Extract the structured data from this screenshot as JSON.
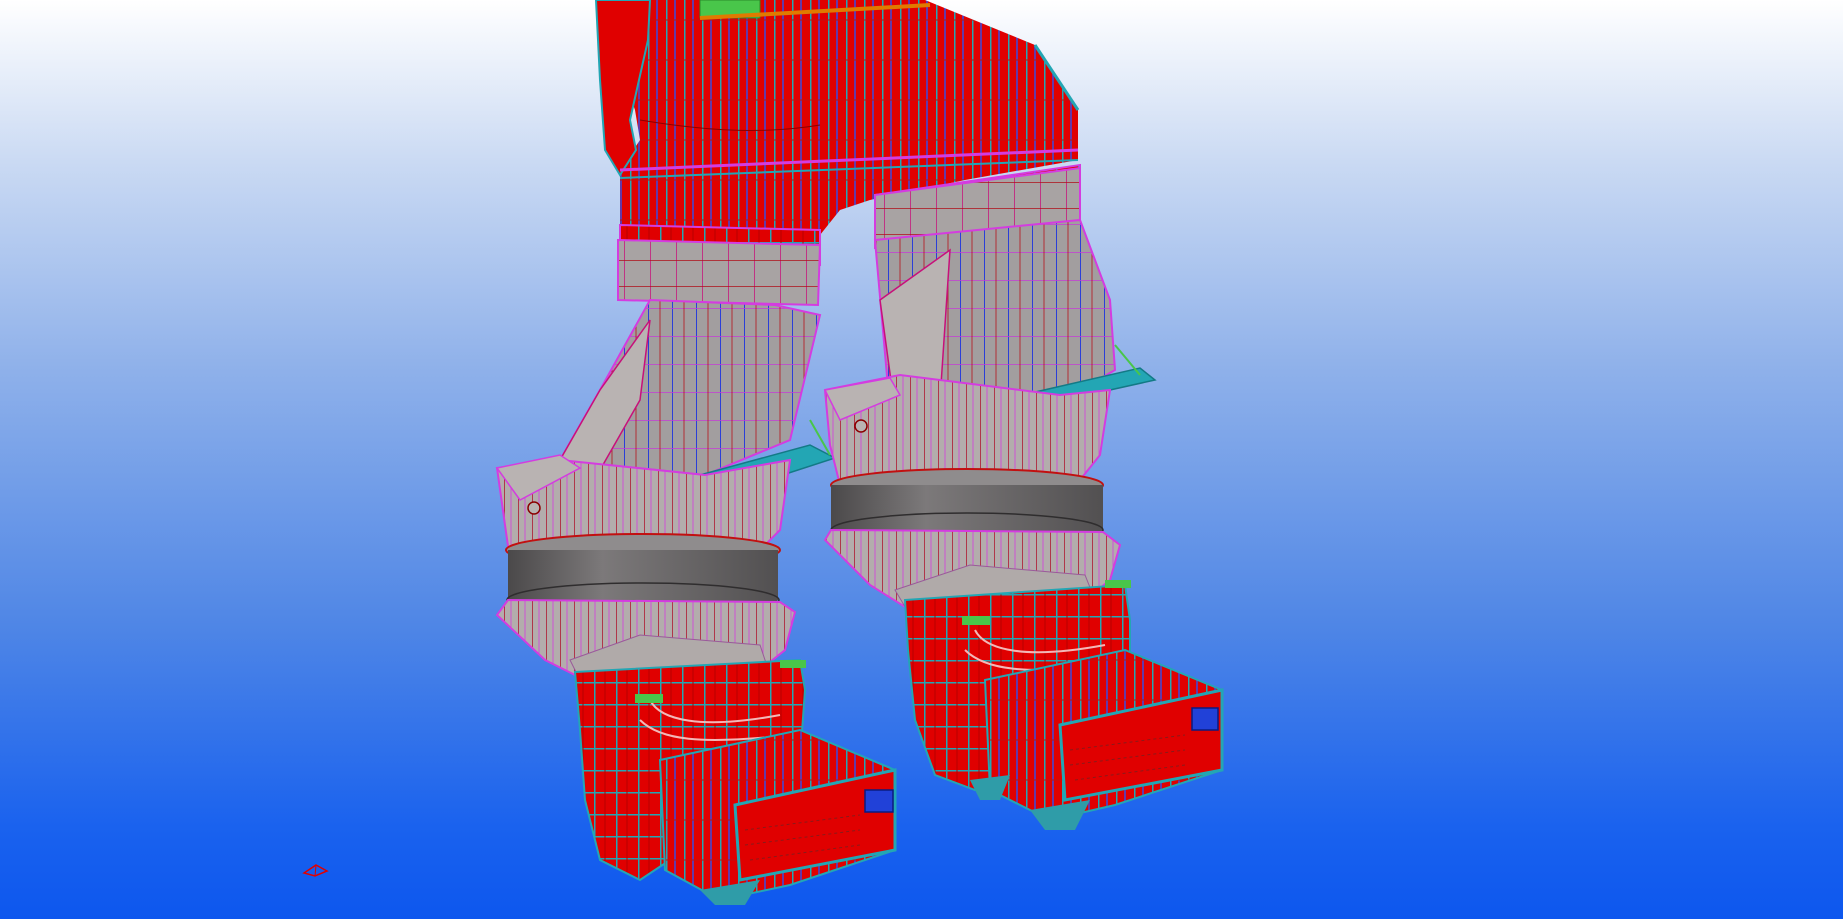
{
  "viewer": {
    "model_name": "",
    "colors": {
      "steel_red": "#e00000",
      "stiffener_teal": "#23a6b4",
      "magenta_edge": "#d43ce0",
      "blue_rib": "#1b3fe0",
      "gray_panel": "#a7a3a3",
      "drum_gray": "#6e6c6e",
      "green_top": "#49c64a",
      "orange_detail": "#e07a00"
    },
    "icons": {
      "axis": "axis-triad-icon"
    }
  }
}
